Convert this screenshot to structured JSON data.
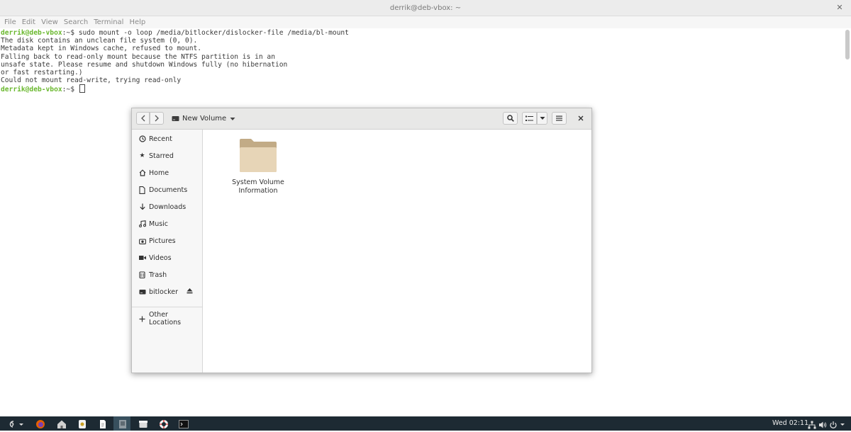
{
  "terminal": {
    "title": "derrik@deb-vbox: ~",
    "menu": [
      "File",
      "Edit",
      "View",
      "Search",
      "Terminal",
      "Help"
    ],
    "prompt_user": "derrik@deb-vbox",
    "prompt_path": ":~$ ",
    "command": "sudo mount -o loop /media/bitlocker/dislocker-file /media/bl-mount",
    "output_lines": [
      "The disk contains an unclean file system (0, 0).",
      "Metadata kept in Windows cache, refused to mount.",
      "Falling back to read-only mount because the NTFS partition is in an",
      "unsafe state. Please resume and shutdown Windows fully (no hibernation",
      "or fast restarting.)",
      "Could not mount read-write, trying read-only"
    ],
    "prompt2_user": "derrik@deb-vbox",
    "prompt2_path": ":~$ "
  },
  "file_manager": {
    "location": "New Volume",
    "sidebar": [
      {
        "label": "Recent",
        "icon": "clock-icon"
      },
      {
        "label": "Starred",
        "icon": "star-icon"
      },
      {
        "label": "Home",
        "icon": "home-icon"
      },
      {
        "label": "Documents",
        "icon": "document-icon"
      },
      {
        "label": "Downloads",
        "icon": "download-icon"
      },
      {
        "label": "Music",
        "icon": "music-icon"
      },
      {
        "label": "Pictures",
        "icon": "camera-icon"
      },
      {
        "label": "Videos",
        "icon": "video-icon"
      },
      {
        "label": "Trash",
        "icon": "trash-icon"
      },
      {
        "label": "bitlocker",
        "icon": "drive-icon"
      }
    ],
    "other_locations": "Other Locations",
    "items": [
      {
        "line1": "System Volume",
        "line2": "Information"
      }
    ],
    "folder_color": "#e7d5b7"
  },
  "taskbar": {
    "clock": "Wed 02:11",
    "background": "#1d2a33"
  }
}
